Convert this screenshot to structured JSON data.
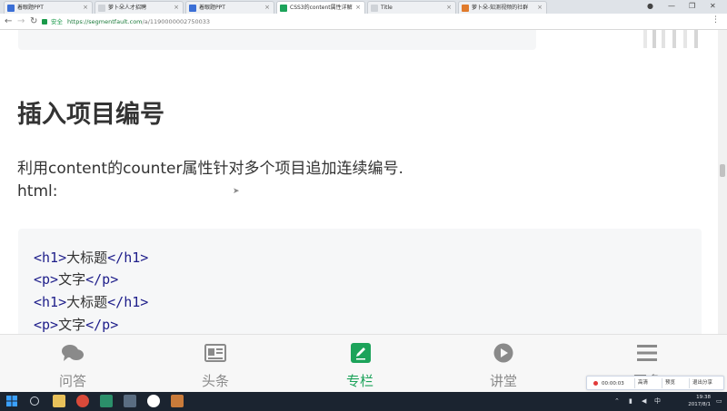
{
  "tabs": [
    {
      "title": "着眼题PPT",
      "icon_color": "#3b6fd6",
      "active": false
    },
    {
      "title": "萝卜朵人才招聘",
      "icon_color": "#cfd3d8",
      "active": false
    },
    {
      "title": "着眼题PPT",
      "icon_color": "#3b6fd6",
      "active": false
    },
    {
      "title": "CSS3的content属性详解",
      "icon_color": "#1ca35a",
      "active": true
    },
    {
      "title": "Title",
      "icon_color": "#cfd3d8",
      "active": false
    },
    {
      "title": "萝卜朵-知测视频的社群",
      "icon_color": "#e07b2c",
      "active": false
    }
  ],
  "address_bar": {
    "secure_label": "安全",
    "url_host": "https://segmentfault.com",
    "url_path": "/a/1190000002750033"
  },
  "page": {
    "heading": "插入项目编号",
    "paragraph": "利用content的counter属性针对多个项目追加连续编号.",
    "html_label": "html:",
    "code_lines": [
      {
        "open": "<h1>",
        "text": "大标题",
        "close": "</h1>"
      },
      {
        "open": "<p>",
        "text": "文字",
        "close": "</p>"
      },
      {
        "open": "<h1>",
        "text": "大标题",
        "close": "</h1>"
      },
      {
        "open": "<p>",
        "text": "文字",
        "close": "</p>"
      }
    ]
  },
  "bottom_nav": [
    {
      "label": "问答",
      "icon": "chat-bubbles-icon",
      "active": false
    },
    {
      "label": "头条",
      "icon": "newspaper-icon",
      "active": false
    },
    {
      "label": "专栏",
      "icon": "pencil-square-icon",
      "active": true
    },
    {
      "label": "讲堂",
      "icon": "play-circle-icon",
      "active": false
    },
    {
      "label": "更多",
      "icon": "menu-icon",
      "active": false
    }
  ],
  "recorder": {
    "time": "00:00:03",
    "buttons": [
      "高清",
      "预览",
      "退出分享"
    ]
  },
  "taskbar": {
    "time": "19:38",
    "date": "2017/8/1"
  },
  "colors": {
    "accent_green": "#1ca35a",
    "code_tag": "#1e1e8a",
    "taskbar_bg": "#1b2430"
  }
}
